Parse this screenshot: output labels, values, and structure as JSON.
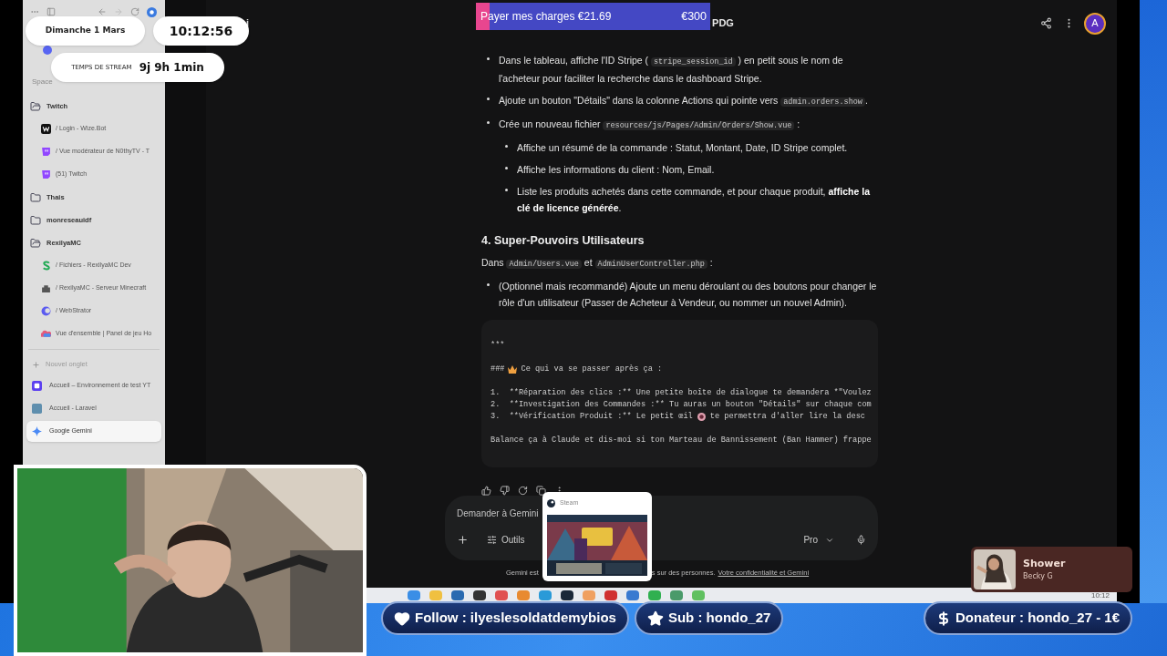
{
  "overlay": {
    "date": "Dimanche 1 Mars",
    "clock": "10:12:56",
    "stream_label": "TEMPS DE STREAM",
    "stream_time": "9j 9h 1min"
  },
  "goal": {
    "label": "Payer mes charges €21.69",
    "target": "€300",
    "level": 0.06
  },
  "browser": {
    "sidebar": {
      "space": "Space",
      "tree": [
        {
          "label": "Twitch",
          "expanded": true,
          "children": [
            {
              "label": "/ Login - Wize.Bot"
            },
            {
              "label": "/ Vue modérateur de N0thyTV - T"
            },
            {
              "label": "(51) Twitch"
            }
          ]
        },
        {
          "label": "Thais",
          "expanded": false
        },
        {
          "label": "monreseauidf",
          "expanded": false
        },
        {
          "label": "RexilyaMC",
          "expanded": true,
          "children": [
            {
              "label": "/ Fichiers - RexilyaMC Dev"
            },
            {
              "label": "/ RexilyaMC - Serveur Minecraft"
            },
            {
              "label": "/ WebStrator"
            },
            {
              "label": "Vue d'ensemble | Panel de jeu Ho"
            }
          ]
        }
      ],
      "new_tab": "Nouvel onglet",
      "tabs": [
        {
          "label": "Accueil – Environnement de test YT",
          "selected": false
        },
        {
          "label": "Accueil - Laravel",
          "selected": false
        },
        {
          "label": "Google Gemini",
          "selected": true
        }
      ]
    },
    "header": {
      "left_text": "i",
      "title": "PDG",
      "avatar": "A"
    },
    "content": [
      {
        "kind": "bullet",
        "parts": [
          {
            "kind": "text",
            "text": "Dans le tableau, affiche l'ID Stripe ( "
          },
          {
            "kind": "code",
            "text": "stripe_session_id"
          },
          {
            "kind": "text",
            "text": " ) en petit sous le nom de l'acheteur pour faciliter la recherche dans le dashboard Stripe."
          }
        ]
      },
      {
        "kind": "bullet",
        "parts": [
          {
            "kind": "text",
            "text": "Ajoute un bouton \"Détails\" dans la colonne Actions qui pointe vers "
          },
          {
            "kind": "code",
            "text": "admin.orders.show"
          },
          {
            "kind": "text",
            "text": "."
          }
        ]
      },
      {
        "kind": "bullet",
        "parts": [
          {
            "kind": "text",
            "text": "Crée un nouveau fichier "
          },
          {
            "kind": "code",
            "text": "resources/js/Pages/Admin/Orders/Show.vue"
          },
          {
            "kind": "text",
            "text": " :"
          }
        ],
        "children": [
          {
            "kind": "bullet",
            "parts": [
              {
                "kind": "text",
                "text": "Affiche un résumé de la commande : Statut, Montant, Date, ID Stripe complet."
              }
            ]
          },
          {
            "kind": "bullet",
            "parts": [
              {
                "kind": "text",
                "text": "Affiche les informations du client : Nom, Email."
              }
            ]
          },
          {
            "kind": "bullet",
            "parts": [
              {
                "kind": "text",
                "text": "Liste les produits achetés dans cette commande, et pour chaque produit, "
              },
              {
                "kind": "bold",
                "text": "affiche la clé de licence générée"
              },
              {
                "kind": "text",
                "text": "."
              }
            ]
          }
        ]
      },
      {
        "kind": "heading",
        "text": "4. Super-Pouvoirs Utilisateurs"
      },
      {
        "kind": "paragraph",
        "parts": [
          {
            "kind": "text",
            "text": "Dans "
          },
          {
            "kind": "code",
            "text": "Admin/Users.vue"
          },
          {
            "kind": "text",
            "text": " et "
          },
          {
            "kind": "code",
            "text": "AdminUserController.php"
          },
          {
            "kind": "text",
            "text": " :"
          }
        ]
      },
      {
        "kind": "bullet",
        "parts": [
          {
            "kind": "text",
            "text": "(Optionnel mais recommandé) Ajoute un menu déroulant ou des boutons pour changer le rôle d'un utilisateur (Passer de Acheteur à Vendeur, ou nommer un nouvel Admin)."
          }
        ]
      },
      {
        "kind": "code_block",
        "paragraphs": [
          [
            {
              "kind": "text",
              "text": "***"
            }
          ],
          [
            {
              "kind": "emoji",
              "before": "###",
              "after": "Ce qui va se passer après ça :"
            }
          ],
          [
            {
              "kind": "text",
              "text": "1.  **Réparation des clics :** Une petite boîte de dialogue te demandera *\"Voulez"
            },
            {
              "kind": "text",
              "text": "2.  **Investigation des Commandes :** Tu auras un bouton \"Détails\" sur chaque com"
            },
            {
              "kind": "emoji",
              "before": "3.  **Vérification Produit :** Le petit œil",
              "after": "te permettra d'aller lire la desc"
            }
          ],
          [
            {
              "kind": "text",
              "text": "Balance ça à Claude et dis-moi si ton Marteau de Bannissement (Ban Hammer) frappe"
            }
          ]
        ]
      }
    ],
    "composer": {
      "placeholder": "Demander à Gemini",
      "tools": "Outils",
      "model": "Pro"
    },
    "footer": {
      "start": "Gemini est",
      "middle": "s sur des personnes.",
      "link": "Votre confidentialité et Gemini"
    }
  },
  "steam_preview": {
    "title": "Steam"
  },
  "music": {
    "title": "Shower",
    "artist": "Becky G"
  },
  "alerts": [
    {
      "kind": "follow",
      "text": "Follow : ilyeslesoldatdemybios"
    },
    {
      "kind": "sub",
      "text": "Sub : hondo_27"
    },
    {
      "kind": "donation",
      "text": "Donateur : hondo_27 - 1€"
    }
  ],
  "taskbar": {
    "clock": "10:12"
  }
}
